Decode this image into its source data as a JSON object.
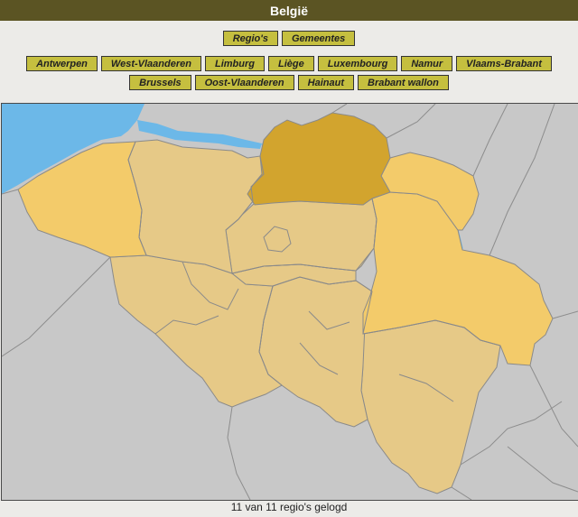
{
  "title": "België",
  "tabs": [
    {
      "label": "Regio's"
    },
    {
      "label": "Gemeentes"
    }
  ],
  "regions": [
    {
      "label": "Antwerpen",
      "state": "selected",
      "color": "#d2a42e"
    },
    {
      "label": "West-Vlaanderen",
      "state": "found",
      "color": "#f3cb6a"
    },
    {
      "label": "Limburg",
      "state": "found",
      "color": "#f3cb6a"
    },
    {
      "label": "Liège",
      "state": "found",
      "color": "#f3cb6a"
    },
    {
      "label": "Luxembourg",
      "state": "found",
      "color": "#e6c987"
    },
    {
      "label": "Namur",
      "state": "found",
      "color": "#e6c987"
    },
    {
      "label": "Vlaams-Brabant",
      "state": "found",
      "color": "#e6c987"
    },
    {
      "label": "Brussels",
      "state": "found",
      "color": "#e6c987"
    },
    {
      "label": "Oost-Vlaanderen",
      "state": "found",
      "color": "#e6c987"
    },
    {
      "label": "Hainaut",
      "state": "found",
      "color": "#e6c987"
    },
    {
      "label": "Brabant wallon",
      "state": "found",
      "color": "#e6c987"
    }
  ],
  "colors": {
    "header_bg": "#5b5423",
    "button_bg": "#c5bf3f",
    "sea": "#6cb8e8",
    "neighbor_land": "#c8c8c8",
    "border": "#8a8a8a",
    "river": "#7fc1e6"
  },
  "status_text": "11 van 11 regio's gelogd"
}
